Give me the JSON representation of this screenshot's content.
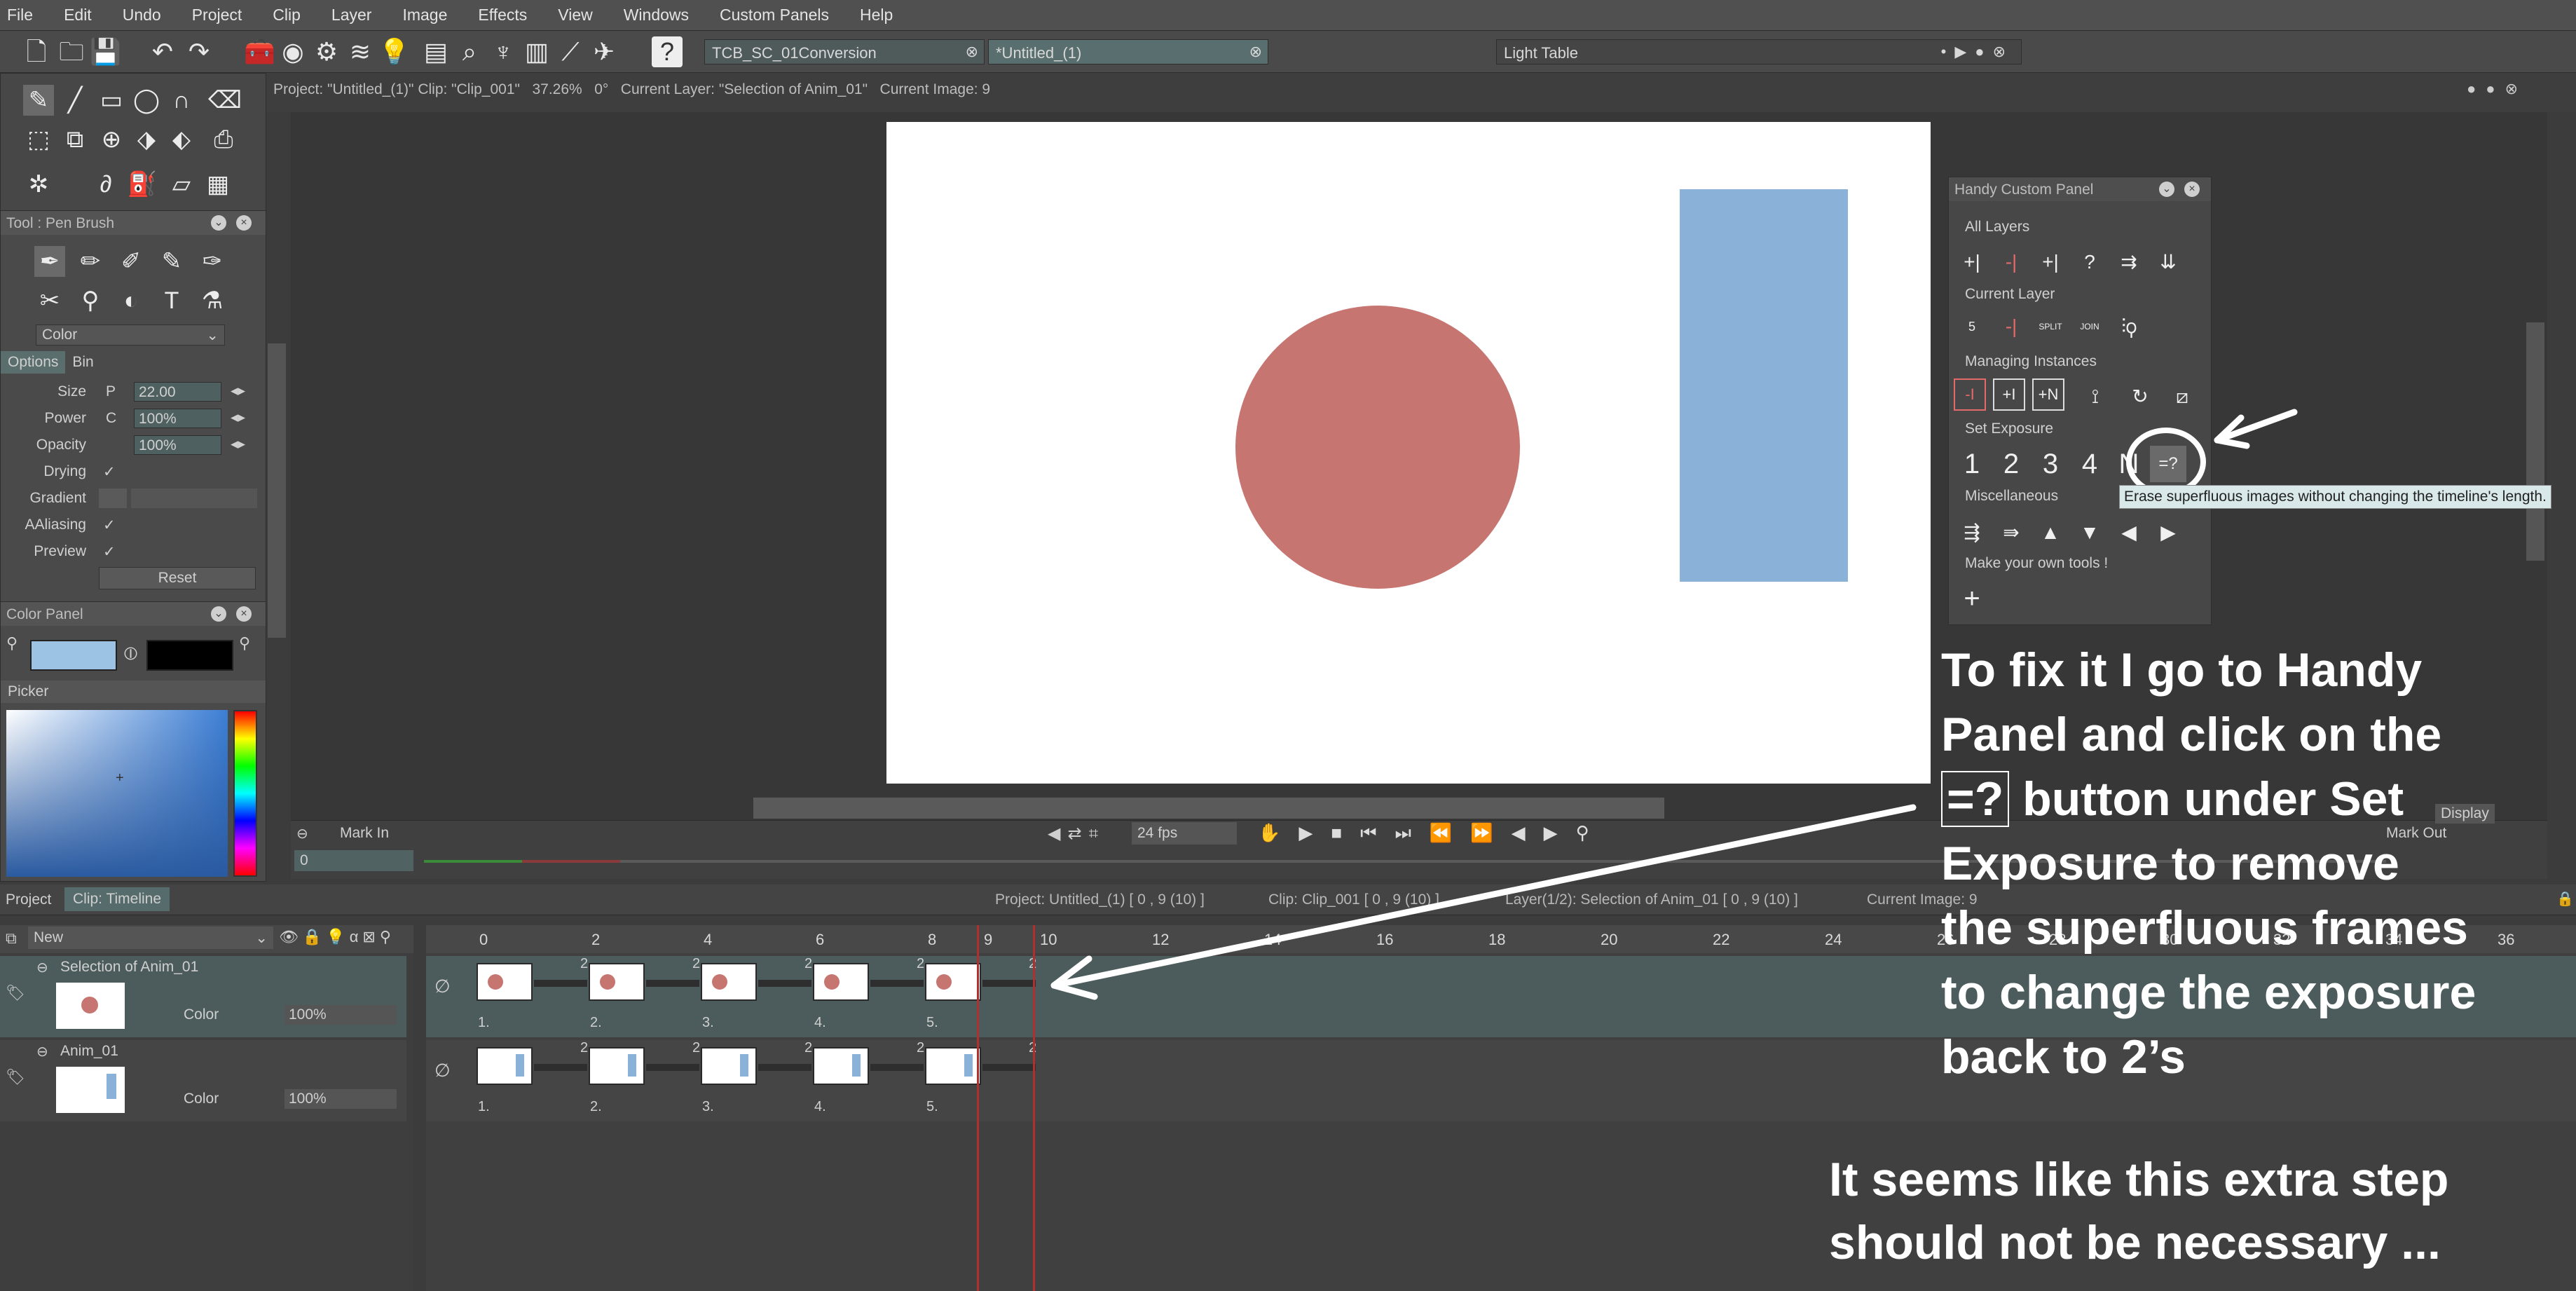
{
  "menu": [
    "File",
    "Edit",
    "Undo",
    "Project",
    "Clip",
    "Layer",
    "Image",
    "Effects",
    "View",
    "Windows",
    "Custom Panels",
    "Help"
  ],
  "toolbar": {
    "project_tab": "TCB_SC_01Conversion",
    "untitled_tab": "*Untitled_(1)",
    "light_table": "Light Table"
  },
  "status_bar": "Project: \"Untitled_(1)\" Clip: \"Clip_001\"   37.26%   0°   Current Layer: \"Selection of Anim_01\"   Current Image: 9",
  "tool_panel": {
    "title": "Tool : Pen Brush",
    "color_dropdown": "Color",
    "tabs": [
      "Options",
      "Bin"
    ],
    "props": [
      {
        "label": "Size",
        "prefix": "P",
        "value": "22.00"
      },
      {
        "label": "Power",
        "prefix": "C",
        "value": "100%"
      },
      {
        "label": "Opacity",
        "prefix": "",
        "value": "100%"
      },
      {
        "label": "Drying",
        "prefix": "",
        "value": "✓"
      },
      {
        "label": "Gradient",
        "prefix": "",
        "value": ""
      },
      {
        "label": "AAliasing",
        "prefix": "",
        "value": "✓"
      },
      {
        "label": "Preview",
        "prefix": "",
        "value": "✓"
      }
    ],
    "reset": "Reset"
  },
  "color_panel": {
    "title": "Color Panel",
    "picker": "Picker",
    "primary_color": "#9cc3e4",
    "secondary_color": "#000000"
  },
  "canvas": {
    "circle_color": "#c67571",
    "rect_color": "#8ab2d8"
  },
  "playback": {
    "mark_in": "Mark In",
    "mark_out": "Mark Out",
    "fps": "24 fps",
    "frame_field": "0",
    "display": "Display"
  },
  "handy_panel": {
    "title": "Handy Custom Panel",
    "sections": [
      "All Layers",
      "Current Layer",
      "Managing Instances",
      "Set Exposure",
      "Miscellaneous",
      "Make your own tools !"
    ],
    "exposure_buttons": [
      "1",
      "2",
      "3",
      "4",
      "N",
      "=?"
    ],
    "tooltip": "Erase superfluous images without changing the timeline's length.",
    "current_layer_labels": [
      "5",
      "SPLIT",
      "JOIN"
    ]
  },
  "timeline": {
    "tabs": [
      "Project",
      "Clip: Timeline"
    ],
    "info": {
      "project": "Project: Untitled_(1) [ 0 , 9  (10) ]",
      "clip": "Clip: Clip_001 [ 0 , 9  (10) ]",
      "layer": "Layer(1/2): Selection of Anim_01 [ 0 , 9  (10) ]",
      "current_image": "Current Image: 9"
    },
    "new_label": "New",
    "ruler": [
      "0",
      "2",
      "4",
      "6",
      "8",
      "9",
      "10",
      "12",
      "14",
      "16",
      "18",
      "20",
      "22",
      "24",
      "26",
      "28",
      "30",
      "32",
      "34",
      "36"
    ],
    "layers": [
      {
        "name": "Selection of Anim_01",
        "mode": "Color",
        "opacity": "100%"
      },
      {
        "name": "Anim_01",
        "mode": "Color",
        "opacity": "100%"
      }
    ],
    "cell_numbers": [
      "1.",
      "2.",
      "3.",
      "4.",
      "5."
    ],
    "exposure_marks": [
      "2",
      "2",
      "2",
      "2",
      "2"
    ]
  },
  "annotations": {
    "main": [
      "To fix it I go to Handy",
      "Panel and click on the",
      "=?",
      "button under Set",
      "Exposure to remove",
      "the superfluous frames",
      "to change the exposure",
      "back to 2’s"
    ],
    "note": [
      "It seems like this extra step",
      "should not be necessary ..."
    ]
  }
}
